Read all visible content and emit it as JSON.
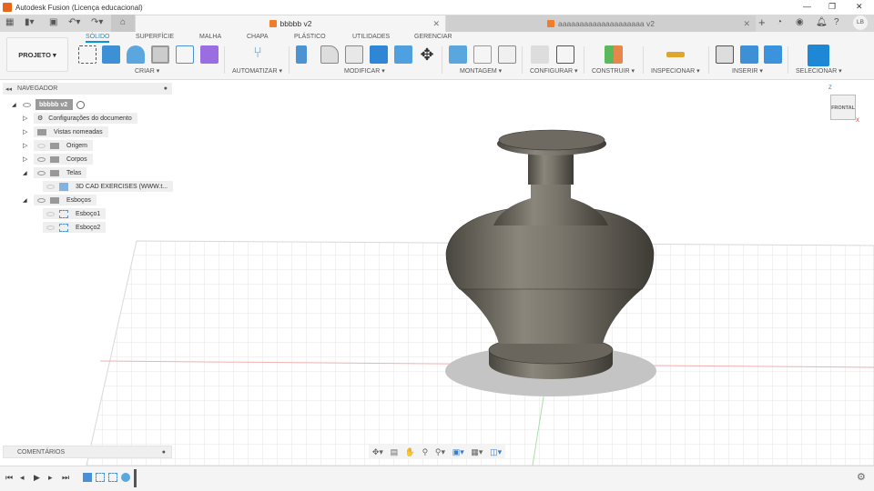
{
  "app": {
    "title": "Autodesk Fusion (Licença educacional)",
    "user_initials": "LB"
  },
  "tabs": [
    {
      "label": "bbbbb v2",
      "active": true
    },
    {
      "label": "aaaaaaaaaaaaaaaaaaaa v2",
      "active": false
    }
  ],
  "toolbar": {
    "project_label": "PROJETO ▾",
    "workspace_tabs": [
      "SÓLIDO",
      "SUPERFÍCIE",
      "MALHA",
      "CHAPA",
      "PLÁSTICO",
      "UTILIDADES",
      "GERENCIAR"
    ],
    "groups": [
      "CRIAR ▾",
      "AUTOMATIZAR ▾",
      "MODIFICAR ▾",
      "MONTAGEM ▾",
      "CONFIGURAR ▾",
      "CONSTRUIR ▾",
      "INSPECIONAR ▾",
      "INSERIR ▾",
      "SELECIONAR ▾"
    ]
  },
  "navigator": {
    "title": "NAVEGADOR",
    "items": [
      {
        "label": "bbbbb v2"
      },
      {
        "label": "Configurações do documento"
      },
      {
        "label": "Vistas nomeadas"
      },
      {
        "label": "Origem"
      },
      {
        "label": "Corpos"
      },
      {
        "label": "Telas"
      },
      {
        "label": "3D CAD EXERCISES (WWW.t..."
      },
      {
        "label": "Esboços"
      },
      {
        "label": "Esboço1"
      },
      {
        "label": "Esboço2"
      }
    ]
  },
  "viewcube": {
    "face": "FRONTAL",
    "axis_z": "Z",
    "axis_x": "X"
  },
  "comments": {
    "label": "COMENTÁRIOS"
  },
  "colors": {
    "accent": "#0696d7",
    "orange": "#f07d2a"
  }
}
